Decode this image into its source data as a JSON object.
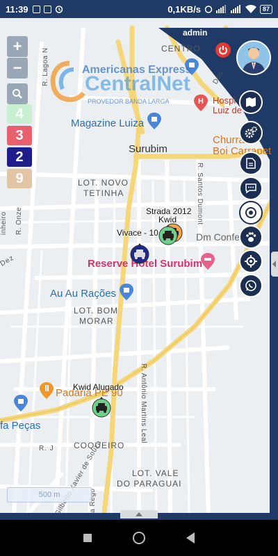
{
  "status_bar": {
    "time": "11:39",
    "net_speed": "0,1KB/s",
    "battery": "87"
  },
  "header": {
    "user": "admin"
  },
  "logo": {
    "line1": "Americanas Express",
    "line2": "CentralNet",
    "line3": "PROVEDOR BANDA LARGA"
  },
  "zoom": {
    "plus": "+",
    "minus": "−"
  },
  "vehicle_counts": [
    {
      "value": "4",
      "color": "#c9efd2"
    },
    {
      "value": "3",
      "color": "#e8606e"
    },
    {
      "value": "2",
      "color": "#1d1d8c"
    },
    {
      "value": "9",
      "color": "#e2c6a3"
    }
  ],
  "map_labels": {
    "centro": "CENTRO",
    "surubim": "Surubim",
    "lot_novo_tetinha_1": "LOT. NOVO",
    "lot_novo_tetinha_2": "TETINHA",
    "lot_bom_morar_1": "LOT. BOM",
    "lot_bom_morar_2": "MORAR",
    "coqueiro": "COQUEIRO",
    "lot_vale_1": "LOT. VALE",
    "lot_vale_2": "DO PARAGUAI",
    "magazine_luiza": "Magazine Luiza",
    "reserve_hotel": "Reserve Hotel Surubim",
    "au_au": "Au Au Rações",
    "hospital_1": "Hospi",
    "hospital_2": "Luiz de",
    "churras_1": "Churra",
    "churras_2": "Boi Carrapet",
    "dm_conf": "Dm Confe",
    "padaria": "Padaria PE 90",
    "fa_pecas": "fa Peças",
    "r_santos_dumont": "R. Santos Dumont",
    "r_antonio_martins": "R. Antônio Martins Leal",
    "r_lagoa": "R. Lagoa N",
    "r_onze": "R. Onze",
    "r_gilberto": "R. Gilberto Xavier de Souza",
    "silva_rego": "Silva Rêgo",
    "r_j": "R. J",
    "pinheiro": "inheiro",
    "dez": "Dez",
    "dos": "Dos"
  },
  "vehicles": [
    {
      "label": "Strada 2012",
      "color": "#f3a44b"
    },
    {
      "label": "Kwid",
      "color": "#6fd08a"
    },
    {
      "label": "Vivace - 10",
      "color": "#1f2a86"
    },
    {
      "label": "Kwid Alugado",
      "color": "#6fd08a"
    }
  ],
  "side_buttons": [
    {
      "name": "map-icon",
      "active": false
    },
    {
      "name": "settings-icon",
      "active": false
    },
    {
      "name": "report-icon",
      "active": false
    },
    {
      "name": "chat-icon",
      "active": false
    },
    {
      "name": "target-icon",
      "active": true
    },
    {
      "name": "paw-icon",
      "active": false
    },
    {
      "name": "locate-icon",
      "active": false
    },
    {
      "name": "whatsapp-icon",
      "active": false
    }
  ],
  "scale": {
    "label": "500 m"
  }
}
